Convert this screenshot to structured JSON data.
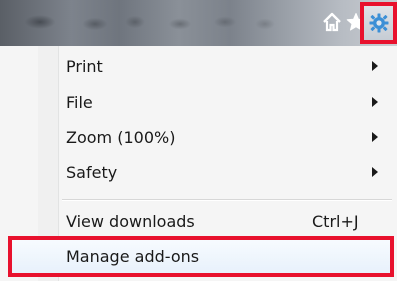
{
  "toolbar": {
    "icons": [
      "home-icon",
      "star-icon",
      "gear-icon"
    ]
  },
  "menu": {
    "items": [
      {
        "label": "Print",
        "submenu": true
      },
      {
        "label": "File",
        "submenu": true
      },
      {
        "label": "Zoom (100%)",
        "submenu": true
      },
      {
        "label": "Safety",
        "submenu": true
      },
      {
        "label": "View downloads",
        "shortcut": "Ctrl+J"
      },
      {
        "label": "Manage add-ons",
        "highlighted": true
      }
    ]
  },
  "colors": {
    "highlight": "#e8112d",
    "menu_background": "#f5f5f5"
  }
}
